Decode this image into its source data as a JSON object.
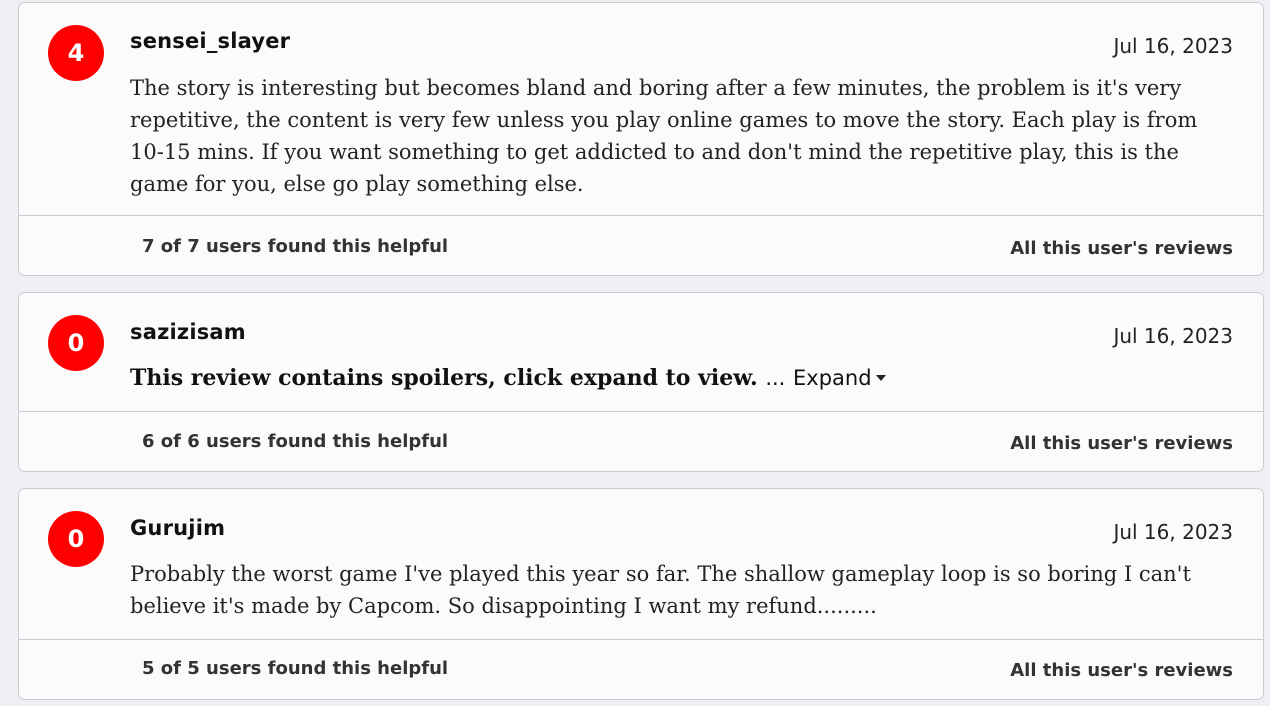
{
  "reviews": [
    {
      "score": "4",
      "username": "sensei_slayer",
      "date": "Jul 16, 2023",
      "text": "The story is interesting but becomes bland and boring after a few minutes, the problem is it's very repetitive, the content is very few unless you play online games to move the story. Each play is from 10-15 mins. If you want something to get addicted to and don't mind the repetitive play, this is the game for you, else go play something else.",
      "helpful": "7 of 7 users found this helpful",
      "all_reviews_label": "All this user's reviews",
      "score_color": "#ff0000"
    },
    {
      "score": "0",
      "username": "sazizisam",
      "date": "Jul 16, 2023",
      "spoiler_text": "This review contains spoilers, click expand to view.",
      "ellipsis": "...",
      "expand_label": "Expand",
      "helpful": "6 of 6 users found this helpful",
      "all_reviews_label": "All this user's reviews",
      "score_color": "#ff0000"
    },
    {
      "score": "0",
      "username": "Gurujim",
      "date": "Jul 16, 2023",
      "text": "Probably the worst game I've played this year so far. The shallow gameplay loop is so boring I can't believe it's made by Capcom. So disappointing I want my refund.........",
      "helpful": "5 of 5 users found this helpful",
      "all_reviews_label": "All this user's reviews",
      "score_color": "#ff0000"
    }
  ]
}
